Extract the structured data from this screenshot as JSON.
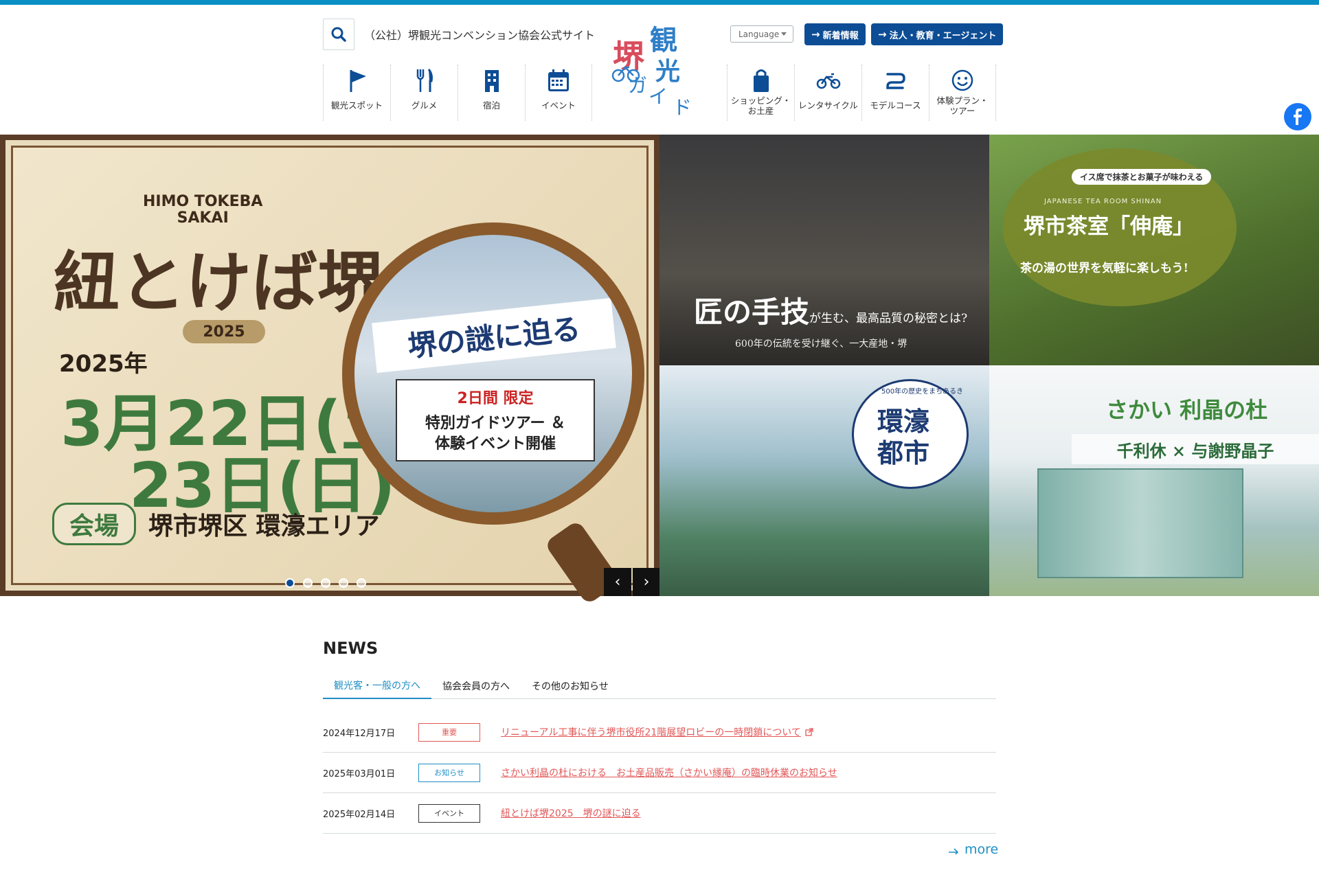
{
  "header": {
    "site_tagline": "（公社）堺観光コンベンション協会公式サイト",
    "logo_text": [
      "堺",
      "観",
      "光",
      "ガ",
      "イ",
      "ド"
    ],
    "language_label": "Language",
    "news_button": "新着情報",
    "business_button": "法人・教育・エージェント"
  },
  "nav_left": [
    {
      "label": "観光スポット",
      "icon": "flag-icon"
    },
    {
      "label": "グルメ",
      "icon": "fork-knife-icon"
    },
    {
      "label": "宿泊",
      "icon": "building-icon"
    },
    {
      "label": "イベント",
      "icon": "calendar-icon"
    }
  ],
  "nav_right": [
    {
      "label": "ショッピング・\nお土産",
      "icon": "shopping-bag-icon"
    },
    {
      "label": "レンタサイクル",
      "icon": "bicycle-icon"
    },
    {
      "label": "モデルコース",
      "icon": "route-icon"
    },
    {
      "label": "体験プラン・\nツアー",
      "icon": "smile-icon"
    }
  ],
  "social": {
    "facebook": "facebook-icon",
    "instagram": "instagram-icon"
  },
  "hero": {
    "main": {
      "subtitle": "HIMO TOKEBA\nSAKAI",
      "title": "紐とけば堺",
      "year": "2025",
      "date_year": "2025年",
      "date_line1": "3月22日(土)",
      "date_line2": "23日(日)",
      "venue_tag": "会場",
      "venue": "堺市堺区 環濠エリア",
      "headline": "堺の謎に迫る",
      "ribbon_line1": "2日間 限定",
      "ribbon_line2": "特別ガイドツアー ＆\n体験イベント開催"
    },
    "tile1": {
      "title": "匠の手技",
      "title_small": "が生む、最高品質の秘密とは?",
      "sub": "600年の伝統を受け継ぐ、一大産地・堺"
    },
    "tile2": {
      "pill": "イス席で抹茶とお菓子が味わえる",
      "en": "JAPANESE TEA ROOM SHINAN",
      "title": "堺市茶室「伸庵」",
      "sub": "茶の湯の世界を気軽に楽しもう!"
    },
    "tile3": {
      "badge_arc": "500年の歴史をまちあるき",
      "badge_title": "環濠\n都市"
    },
    "tile4": {
      "title": "さかい 利晶の杜",
      "bar": "千利休 × 与謝野晶子"
    },
    "slider": {
      "dot_count": 5,
      "active_dot": 0,
      "prev": "‹",
      "next": "›"
    }
  },
  "news": {
    "heading": "NEWS",
    "tabs": [
      "観光客・一般の方へ",
      "協会会員の方へ",
      "その他のお知らせ"
    ],
    "active_tab": 0,
    "items": [
      {
        "date": "2024年12月17日",
        "category": "重要",
        "category_type": "important",
        "title": "リニューアル工事に伴う堺市役所21階展望ロビーの一時閉鎖について",
        "external": true
      },
      {
        "date": "2025年03月01日",
        "category": "お知らせ",
        "category_type": "notice",
        "title": "さかい利晶の杜における　お土産品販売（さかい縁庵）の臨時休業のお知らせ",
        "external": false
      },
      {
        "date": "2025年02月14日",
        "category": "イベント",
        "category_type": "event",
        "title": "紐とけば堺2025　堺の謎に迫る",
        "external": false
      }
    ],
    "more_label": "more"
  },
  "colors": {
    "accent": "#0a8fc4",
    "navy": "#0d4d95",
    "important": "#e25858",
    "link": "#1e8fc4"
  }
}
